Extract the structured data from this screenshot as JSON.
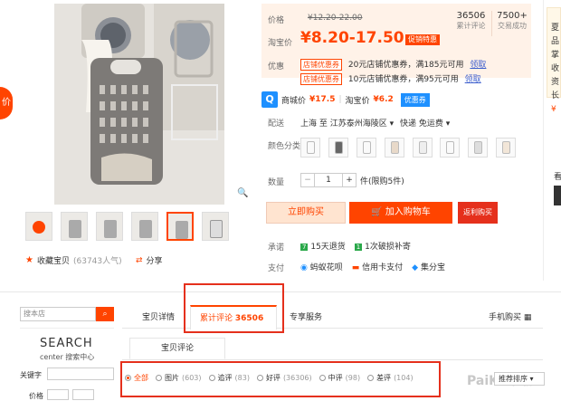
{
  "side_tab": {
    "label": "价"
  },
  "gallery": {
    "thumbnails": 6,
    "favorite_label": "收藏宝贝",
    "favorite_count": "(63743人气)",
    "share_label": "分享"
  },
  "price": {
    "label": "价格",
    "original": "¥12.20-22.00",
    "taobao_label": "淘宝价",
    "current": "¥8.20-17.50",
    "badge": "促销特惠",
    "sales_count": "36506",
    "sales_label": "累计评论",
    "deals_count": "7500+",
    "deals_label": "交易成功"
  },
  "promo": {
    "label": "优惠",
    "items": [
      {
        "tag": "店铺优惠券",
        "text": "20元店铺优惠券，满185元可用",
        "link": "领取"
      },
      {
        "tag": "店铺优惠券",
        "text": "10元店铺优惠券，满95元可用",
        "link": "领取"
      }
    ]
  },
  "compare": {
    "mall_label": "商城价",
    "mall_price": "¥17.5",
    "taobao_label": "淘宝价",
    "taobao_price": "¥6.2",
    "coupon_button": "优惠券"
  },
  "shipping": {
    "label": "配送",
    "route": "上海 至 江苏泰州海陵区",
    "method": "快递 免运费"
  },
  "color": {
    "label": "颜色分类",
    "swatch_count": 8
  },
  "quantity": {
    "label": "数量",
    "value": "1",
    "stock": "件(限购5件)"
  },
  "actions": {
    "buy": "立即购买",
    "cart": "加入购物车",
    "rebate": "返利购买"
  },
  "promise": {
    "label": "承诺",
    "items": [
      "15天退货",
      "1次破损补寄"
    ]
  },
  "payment": {
    "label": "支付",
    "methods": [
      "蚂蚁花呗",
      "信用卡支付",
      "集分宝"
    ]
  },
  "right_panel": {
    "lines": [
      "夏",
      "品",
      "掌",
      "收",
      "资",
      "长",
      "¥"
    ],
    "section": "看"
  },
  "shop_search": {
    "placeholder": "搜本店",
    "logo_top": "SEARCH",
    "logo_bottom": "center 搜索中心",
    "keyword_label": "关键字",
    "price_label": "价格"
  },
  "tabs": {
    "details": "宝贝详情",
    "reviews": "累计评论",
    "reviews_count": "36506",
    "service": "专享服务",
    "mobile": "手机购买"
  },
  "review_subtab": "宝贝评论",
  "review_filters": [
    {
      "label": "全部",
      "count": "",
      "selected": true
    },
    {
      "label": "图片",
      "count": "(603)",
      "selected": false
    },
    {
      "label": "追评",
      "count": "(83)",
      "selected": false
    },
    {
      "label": "好评",
      "count": "(36306)",
      "selected": false
    },
    {
      "label": "中评",
      "count": "(98)",
      "selected": false
    },
    {
      "label": "差评",
      "count": "(104)",
      "selected": false
    }
  ],
  "sort": {
    "label": "推荐排序"
  },
  "watermark": "PaiKu下载"
}
